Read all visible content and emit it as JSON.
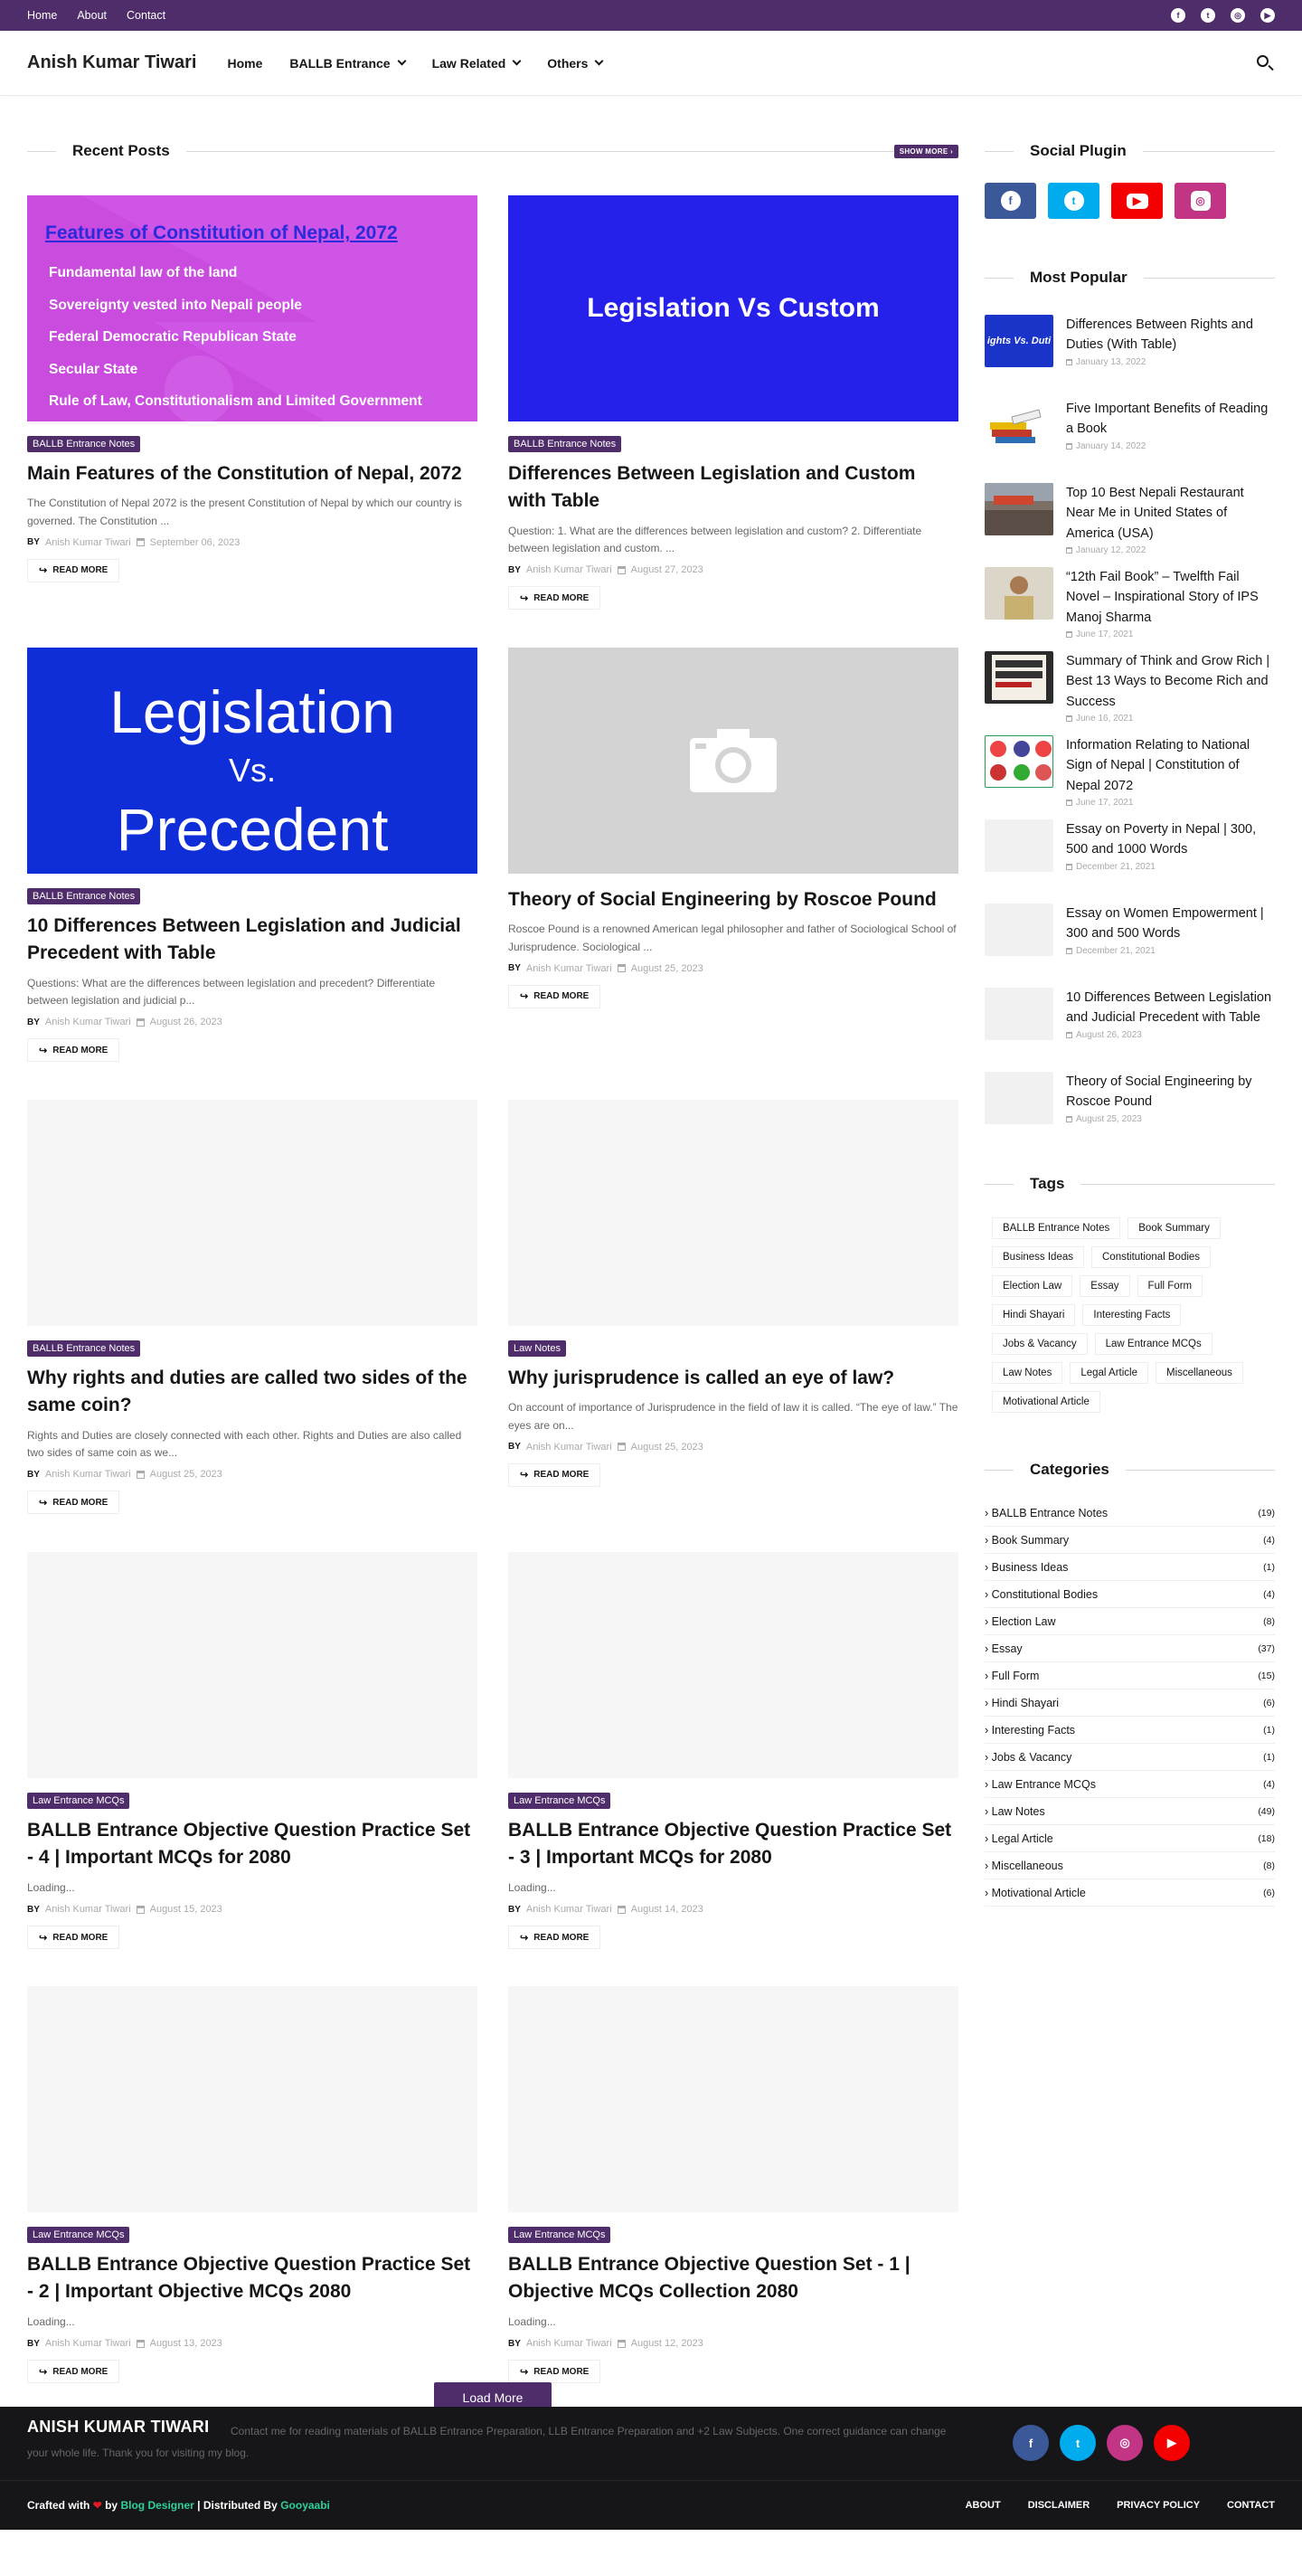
{
  "topbar": {
    "links": [
      "Home",
      "About",
      "Contact"
    ],
    "social": [
      "facebook-icon",
      "twitter-icon",
      "instagram-icon",
      "youtube-icon"
    ]
  },
  "header": {
    "logo": "Anish Kumar Tiwari",
    "nav": [
      "Home",
      "BALLB Entrance",
      "Law Related",
      "Others"
    ]
  },
  "recent": {
    "title": "Recent Posts",
    "show_more": "SHOW MORE ›",
    "load_more": "Load More",
    "posts": [
      {
        "cat": "BALLB Entrance Notes",
        "title": "Main Features of the Constitution of Nepal, 2072",
        "excerpt": "The Constitution of Nepal 2072 is the present Constitution of Nepal by which our country is governed. The Constitution ...",
        "by": "BY",
        "author": "Anish Kumar Tiwari",
        "date": "September 06, 2023",
        "readmore": "READ MORE",
        "image": {
          "heading": "Features of Constitution of Nepal, 2072",
          "lines": [
            "Fundamental law of the land",
            "Sovereignty vested into Nepali people",
            "Federal Democratic Republican State",
            "Secular State",
            "Rule of Law, Constitutionalism and Limited Government"
          ]
        }
      },
      {
        "cat": "BALLB Entrance Notes",
        "title": "Differences Between Legislation and Custom with Table",
        "excerpt": "Question: 1. What are the differences between legislation and custom? 2. Differentiate between legislation and custom. ...",
        "by": "BY",
        "author": "Anish Kumar Tiwari",
        "date": "August 27, 2023",
        "readmore": "READ MORE",
        "image": {
          "text": "Legislation Vs Custom"
        }
      },
      {
        "cat": "BALLB Entrance Notes",
        "title": "10 Differences Between Legislation and Judicial Precedent with Table",
        "excerpt": "Questions: What are the differences between legislation and precedent? Differentiate between legislation and judicial p...",
        "by": "BY",
        "author": "Anish Kumar Tiwari",
        "date": "August 26, 2023",
        "readmore": "READ MORE",
        "image": {
          "l1": "Legislation",
          "l2": "Vs.",
          "l3": "Precedent"
        }
      },
      {
        "cat": "",
        "title": "Theory of Social Engineering by Roscoe Pound",
        "excerpt": "Roscoe Pound is a renowned American legal philosopher and father of Sociological School of Jurisprudence. Sociological ...",
        "by": "BY",
        "author": "Anish Kumar Tiwari",
        "date": "August 25, 2023",
        "readmore": "READ MORE"
      },
      {
        "cat": "BALLB Entrance Notes",
        "title": "Why rights and duties are called two sides of the same coin?",
        "excerpt": "Rights and Duties are closely connected with each other. Rights and Duties are also called two sides of same coin as we...",
        "by": "BY",
        "author": "Anish Kumar Tiwari",
        "date": "August 25, 2023",
        "readmore": "READ MORE"
      },
      {
        "cat": "Law Notes",
        "title": "Why jurisprudence is called an eye of law?",
        "excerpt": "On account of importance of Jurisprudence in the field of law it is called. “The eye of law.” The eyes are on...",
        "by": "BY",
        "author": "Anish Kumar Tiwari",
        "date": "August 25, 2023",
        "readmore": "READ MORE"
      },
      {
        "cat": "Law Entrance MCQs",
        "title": "BALLB Entrance Objective Question Practice Set - 4 | Important MCQs for 2080",
        "excerpt": "Loading...",
        "by": "BY",
        "author": "Anish Kumar Tiwari",
        "date": "August 15, 2023",
        "readmore": "READ MORE"
      },
      {
        "cat": "Law Entrance MCQs",
        "title": "BALLB Entrance Objective Question Practice Set - 3 | Important MCQs for 2080",
        "excerpt": "Loading...",
        "by": "BY",
        "author": "Anish Kumar Tiwari",
        "date": "August 14, 2023",
        "readmore": "READ MORE"
      },
      {
        "cat": "Law Entrance MCQs",
        "title": "BALLB Entrance Objective Question Practice Set - 2 | Important Objective MCQs 2080",
        "excerpt": "Loading...",
        "by": "BY",
        "author": "Anish Kumar Tiwari",
        "date": "August 13, 2023",
        "readmore": "READ MORE"
      },
      {
        "cat": "Law Entrance MCQs",
        "title": "BALLB Entrance Objective Question Set - 1 | Objective MCQs Collection 2080",
        "excerpt": "Loading...",
        "by": "BY",
        "author": "Anish Kumar Tiwari",
        "date": "August 12, 2023",
        "readmore": "READ MORE"
      }
    ]
  },
  "sidebar": {
    "social_title": "Social Plugin",
    "social": [
      {
        "name": "facebook",
        "color": "#3b5999",
        "glyph": "f"
      },
      {
        "name": "twitter",
        "color": "#00acee",
        "glyph": "t"
      },
      {
        "name": "youtube",
        "color": "#f50000",
        "glyph": "▶"
      },
      {
        "name": "instagram",
        "color": "#c13584",
        "glyph": "◎"
      }
    ],
    "popular_title": "Most Popular",
    "popular": [
      {
        "title": "Differences Between Rights and Duties (With Table)",
        "date": "January 13, 2022",
        "thumb": "ights Vs. Duti"
      },
      {
        "title": "Five Important Benefits of Reading a Book",
        "date": "January 14, 2022"
      },
      {
        "title": "Top 10 Best Nepali Restaurant Near Me in United States of America (USA)",
        "date": "January 12, 2022"
      },
      {
        "title": "“12th Fail Book” – Twelfth Fail Novel – Inspirational Story of IPS Manoj Sharma",
        "date": "June 17, 2021"
      },
      {
        "title": "Summary of Think and Grow Rich | Best 13 Ways to Become Rich and Success",
        "date": "June 16, 2021"
      },
      {
        "title": "Information Relating to National Sign of Nepal | Constitution of Nepal 2072",
        "date": "June 17, 2021"
      },
      {
        "title": "Essay on Poverty in Nepal | 300, 500 and 1000 Words",
        "date": "December 21, 2021"
      },
      {
        "title": "Essay on Women Empowerment | 300 and 500 Words",
        "date": "December 21, 2021"
      },
      {
        "title": "10 Differences Between Legislation and Judicial Precedent with Table",
        "date": "August 26, 2023"
      },
      {
        "title": "Theory of Social Engineering by Roscoe Pound",
        "date": "August 25, 2023"
      }
    ],
    "tags_title": "Tags",
    "tags": [
      "BALLB Entrance Notes",
      "Book Summary",
      "Business Ideas",
      "Constitutional Bodies",
      "Election Law",
      "Essay",
      "Full Form",
      "Hindi Shayari",
      "Interesting Facts",
      "Jobs & Vacancy",
      "Law Entrance MCQs",
      "Law Notes",
      "Legal Article",
      "Miscellaneous",
      "Motivational Article"
    ],
    "categories_title": "Categories",
    "categories": [
      {
        "name": "BALLB Entrance Notes",
        "count": "(19)"
      },
      {
        "name": "Book Summary",
        "count": "(4)"
      },
      {
        "name": "Business Ideas",
        "count": "(1)"
      },
      {
        "name": "Constitutional Bodies",
        "count": "(4)"
      },
      {
        "name": "Election Law",
        "count": "(8)"
      },
      {
        "name": "Essay",
        "count": "(37)"
      },
      {
        "name": "Full Form",
        "count": "(15)"
      },
      {
        "name": "Hindi Shayari",
        "count": "(6)"
      },
      {
        "name": "Interesting Facts",
        "count": "(1)"
      },
      {
        "name": "Jobs & Vacancy",
        "count": "(1)"
      },
      {
        "name": "Law Entrance MCQs",
        "count": "(4)"
      },
      {
        "name": "Law Notes",
        "count": "(49)"
      },
      {
        "name": "Legal Article",
        "count": "(18)"
      },
      {
        "name": "Miscellaneous",
        "count": "(8)"
      },
      {
        "name": "Motivational Article",
        "count": "(6)"
      }
    ]
  },
  "footer": {
    "name": "ANISH KUMAR TIWARI",
    "desc": "Contact me for reading materials of BALLB Entrance Preparation, LLB Entrance Preparation and +2 Law Subjects. One correct guidance can change your whole life. Thank you for visiting my blog.",
    "social": [
      {
        "name": "facebook",
        "color": "#3b5999",
        "glyph": "f"
      },
      {
        "name": "twitter",
        "color": "#00acee",
        "glyph": "t"
      },
      {
        "name": "instagram",
        "color": "#c13584",
        "glyph": "◎"
      },
      {
        "name": "youtube",
        "color": "#f50000",
        "glyph": "▶"
      }
    ],
    "credit_a": "Crafted with",
    "credit_heart": "❤",
    "credit_b": "by",
    "designer": "Blog Designer",
    "credit_c": "| Distributed By",
    "distributor": "Gooyaabi",
    "links": [
      "ABOUT",
      "DISCLAIMER",
      "PRIVACY POLICY",
      "CONTACT"
    ]
  },
  "colors": {
    "accent": "#4f2c6a",
    "footer_bg": "#161619"
  }
}
